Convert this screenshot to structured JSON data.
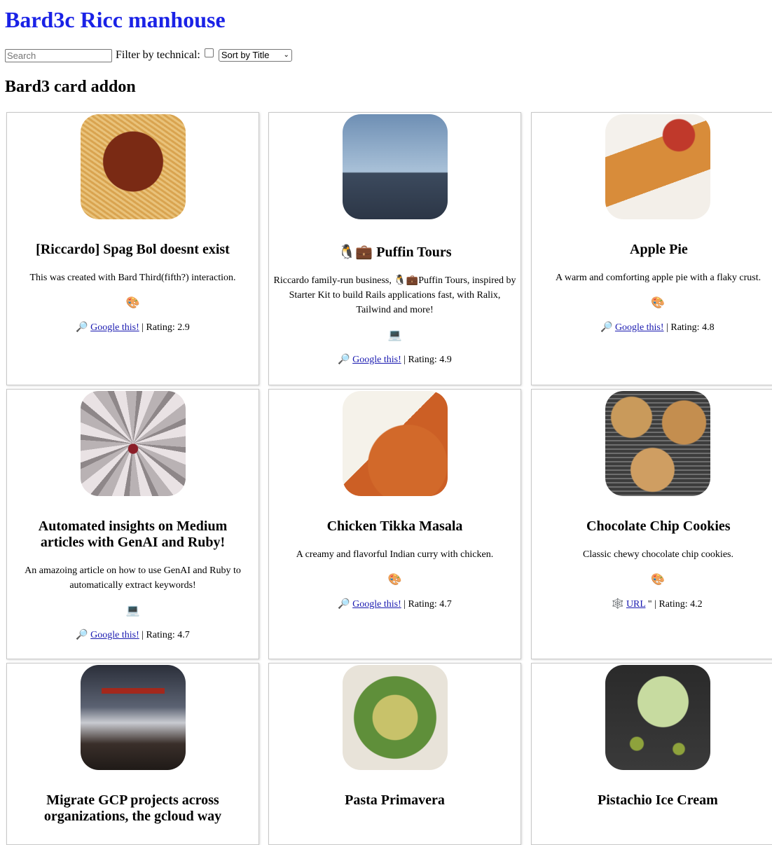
{
  "header": {
    "title": "Bard3c Ricc manhouse"
  },
  "controls": {
    "search_placeholder": "Search",
    "filter_label": "Filter by technical:",
    "sort_selected": "Sort by Title"
  },
  "section": {
    "title": "Bard3 card addon"
  },
  "colors": {
    "title_blue": "#1a22e6",
    "link_blue": "#1a1ab0"
  },
  "cards": [
    {
      "image": "spaghetti-bolognese-image",
      "title": "[Riccardo] Spag Bol doesnt exist",
      "description": "This was created with Bard Third(fifth?) interaction.",
      "emoji": "🎨",
      "link_icon": "🔎",
      "link_text": "Google this!",
      "rating": "| Rating: 2.9"
    },
    {
      "image": "puffin-image",
      "title": "🐧💼 Puffin Tours",
      "description": "Riccardo family-run business, 🐧💼Puffin Tours, inspired by Starter Kit to build Rails applications fast, with Ralix, Tailwind and more!",
      "emoji": "💻",
      "link_icon": "🔎",
      "link_text": "Google this!",
      "rating": "| Rating: 4.9"
    },
    {
      "image": "apple-pie-image",
      "title": "Apple Pie",
      "description": "A warm and comforting apple pie with a flaky crust.",
      "emoji": "🎨",
      "link_icon": "🔎",
      "link_text": "Google this!",
      "rating": "| Rating: 4.8"
    },
    {
      "image": "spider-image",
      "title": "Automated insights on Medium articles with GenAI and Ruby!",
      "description": "An amazoing article on how to use GenAI and Ruby to automatically extract keywords!",
      "emoji": "💻",
      "link_icon": "🔎",
      "link_text": "Google this!",
      "rating": "| Rating: 4.7"
    },
    {
      "image": "chicken-tikka-image",
      "title": "Chicken Tikka Masala",
      "description": "A creamy and flavorful Indian curry with chicken.",
      "emoji": "🎨",
      "link_icon": "🔎",
      "link_text": "Google this!",
      "rating": "| Rating: 4.7"
    },
    {
      "image": "cookies-image",
      "title": "Chocolate Chip Cookies",
      "description": "Classic chewy chocolate chip cookies.",
      "emoji": "🎨",
      "link_icon": "🕸️",
      "link_text": "URL",
      "rating": "\" | Rating: 4.2"
    },
    {
      "image": "torii-gate-image",
      "title": "Migrate GCP projects across organizations, the gcloud way",
      "description": "",
      "emoji": "",
      "link_icon": "",
      "link_text": "",
      "rating": ""
    },
    {
      "image": "pasta-primavera-image",
      "title": "Pasta Primavera",
      "description": "",
      "emoji": "",
      "link_icon": "",
      "link_text": "",
      "rating": ""
    },
    {
      "image": "pistachio-ice-cream-image",
      "title": "Pistachio Ice Cream",
      "description": "",
      "emoji": "",
      "link_icon": "",
      "link_text": "",
      "rating": ""
    }
  ]
}
